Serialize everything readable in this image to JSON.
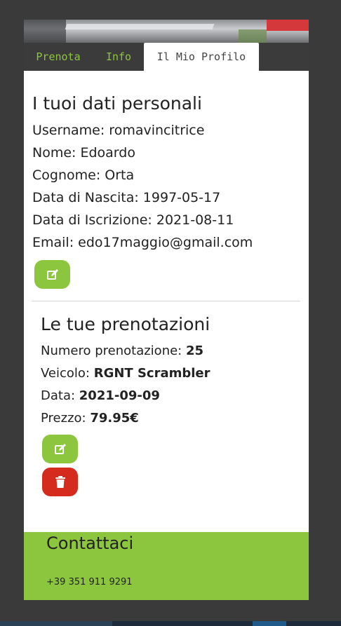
{
  "nav": {
    "tabs": [
      {
        "label": "Prenota"
      },
      {
        "label": "Info"
      },
      {
        "label": "Il Mio Profilo"
      }
    ]
  },
  "profile": {
    "title": "I tuoi dati personali",
    "rows": [
      "Username: romavincitrice",
      "Nome: Edoardo",
      "Cognome: Orta",
      "Data di Nascita: 1997-05-17",
      "Data di Iscrizione: 2021-08-11",
      "Email: edo17maggio@gmail.com"
    ],
    "edit_icon": "edit-icon"
  },
  "booking": {
    "title": "Le tue prenotazioni",
    "number_label": "Numero prenotazione: ",
    "number_value": "25",
    "vehicle_label": "Veicolo: ",
    "vehicle_value": "RGNT Scrambler",
    "date_label": "Data: ",
    "date_value": "2021-09-09",
    "price_label": "Prezzo: ",
    "price_value": "79.95€"
  },
  "footer": {
    "title": "Contattaci",
    "phone": "+39 351 911 9291"
  },
  "colors": {
    "accent": "#8cc63f",
    "danger": "#d42b1e",
    "nav_bg": "#3b3b3b"
  }
}
